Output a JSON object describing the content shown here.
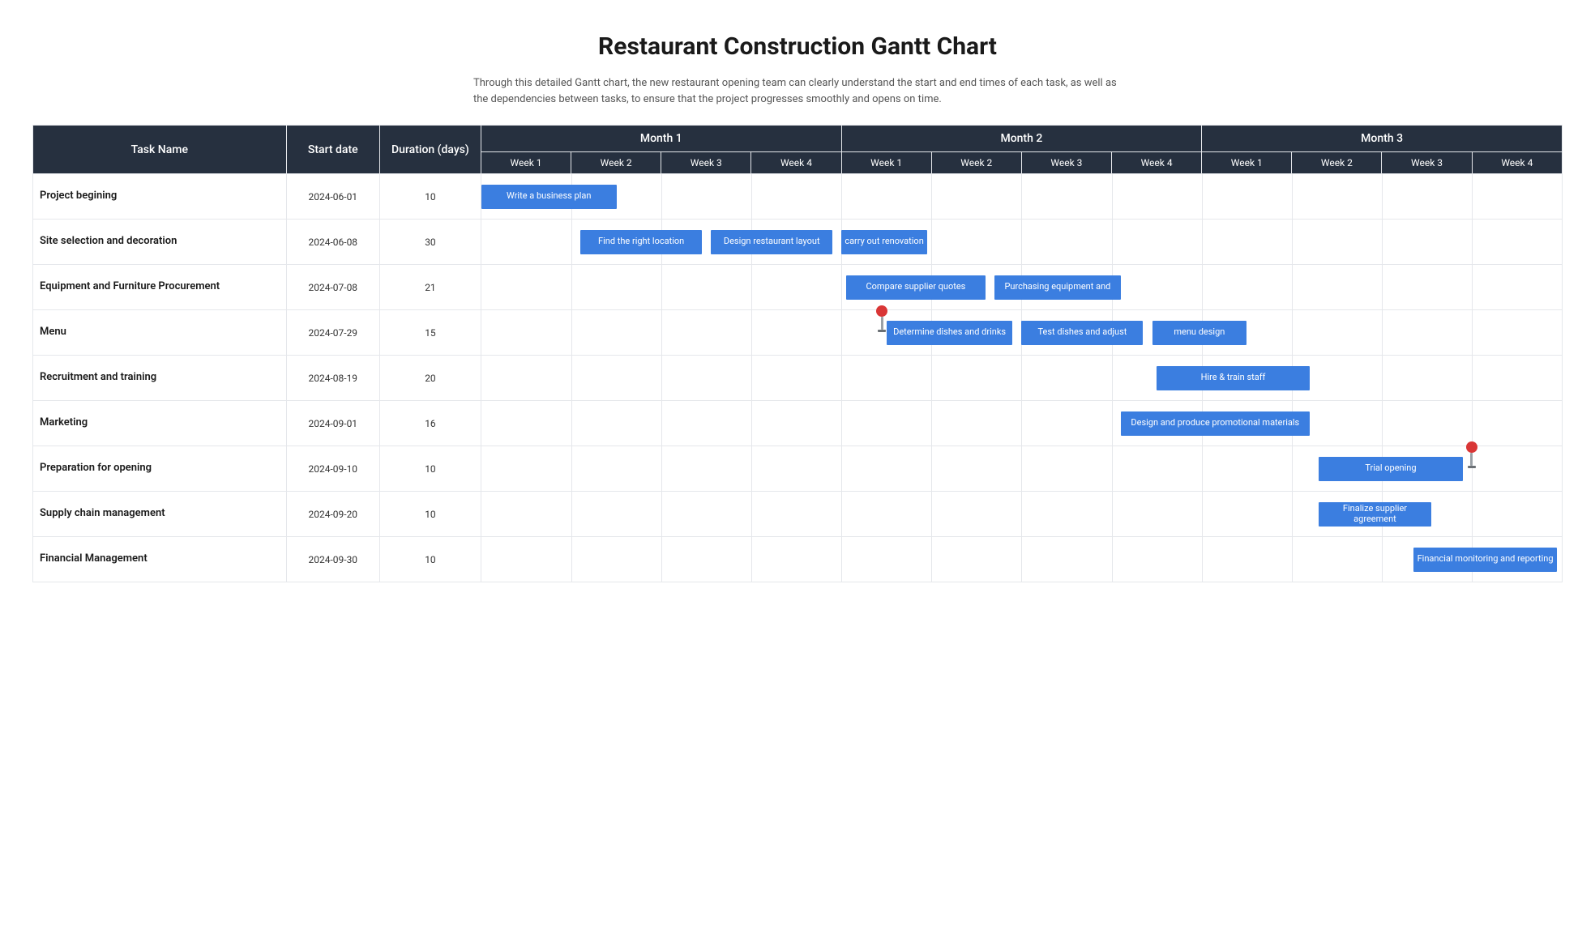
{
  "title": "Restaurant Construction Gantt Chart",
  "subtitle": "Through this detailed Gantt chart, the new restaurant opening team can clearly understand the start and end times of each task, as well as the dependencies between tasks, to ensure that the project progresses smoothly and opens on time.",
  "columns": {
    "task": "Task Name",
    "start": "Start date",
    "duration": "Duration (days)"
  },
  "months": [
    "Month 1",
    "Month 2",
    "Month 3"
  ],
  "weeks": [
    "Week 1",
    "Week 2",
    "Week 3",
    "Week 4"
  ],
  "rows": [
    {
      "name": "Project begining",
      "start": "2024-06-01",
      "duration": "10"
    },
    {
      "name": "Site selection and decoration",
      "start": "2024-06-08",
      "duration": "30"
    },
    {
      "name": "Equipment and Furniture Procurement",
      "start": "2024-07-08",
      "duration": "21"
    },
    {
      "name": "Menu",
      "start": "2024-07-29",
      "duration": "15"
    },
    {
      "name": "Recruitment and training",
      "start": "2024-08-19",
      "duration": "20"
    },
    {
      "name": "Marketing",
      "start": "2024-09-01",
      "duration": "16"
    },
    {
      "name": "Preparation for opening",
      "start": "2024-09-10",
      "duration": "10"
    },
    {
      "name": "Supply chain management",
      "start": "2024-09-20",
      "duration": "10"
    },
    {
      "name": "Financial Management",
      "start": "2024-09-30",
      "duration": "10"
    }
  ],
  "chart_data": {
    "type": "gantt",
    "time_unit": "week",
    "total_weeks": 12,
    "months": [
      "Month 1",
      "Month 2",
      "Month 3"
    ],
    "week_labels": [
      "Week 1",
      "Week 2",
      "Week 3",
      "Week 4",
      "Week 1",
      "Week 2",
      "Week 3",
      "Week 4",
      "Week 1",
      "Week 2",
      "Week 3",
      "Week 4"
    ],
    "tasks": [
      {
        "row": 0,
        "name": "Project begining",
        "start_date": "2024-06-01",
        "duration_days": 10,
        "bars": [
          {
            "label": "Write a business plan",
            "start_week": 0.0,
            "span_weeks": 1.5
          }
        ]
      },
      {
        "row": 1,
        "name": "Site selection and decoration",
        "start_date": "2024-06-08",
        "duration_days": 30,
        "bars": [
          {
            "label": "Find the right location",
            "start_week": 1.1,
            "span_weeks": 1.35
          },
          {
            "label": "Design restaurant layout",
            "start_week": 2.55,
            "span_weeks": 1.35
          },
          {
            "label": "carry out renovation",
            "start_week": 4.0,
            "span_weeks": 0.95
          }
        ]
      },
      {
        "row": 2,
        "name": "Equipment and Furniture Procurement",
        "start_date": "2024-07-08",
        "duration_days": 21,
        "bars": [
          {
            "label": "Compare supplier quotes",
            "start_week": 4.05,
            "span_weeks": 1.55
          },
          {
            "label": "Purchasing equipment and",
            "start_week": 5.7,
            "span_weeks": 1.4
          }
        ]
      },
      {
        "row": 3,
        "name": "Menu",
        "start_date": "2024-07-29",
        "duration_days": 15,
        "bars": [
          {
            "label": "Determine dishes and drinks",
            "start_week": 4.5,
            "span_weeks": 1.4
          },
          {
            "label": "Test dishes and adjust",
            "start_week": 6.0,
            "span_weeks": 1.35
          },
          {
            "label": "menu design",
            "start_week": 7.45,
            "span_weeks": 1.05
          }
        ],
        "pins": [
          {
            "at_week": 4.45
          }
        ]
      },
      {
        "row": 4,
        "name": "Recruitment and training",
        "start_date": "2024-08-19",
        "duration_days": 20,
        "bars": [
          {
            "label": "Hire & train staff",
            "start_week": 7.5,
            "span_weeks": 1.7
          }
        ]
      },
      {
        "row": 5,
        "name": "Marketing",
        "start_date": "2024-09-01",
        "duration_days": 16,
        "bars": [
          {
            "label": "Design and produce promotional materials",
            "start_week": 7.1,
            "span_weeks": 2.1
          }
        ]
      },
      {
        "row": 6,
        "name": "Preparation for opening",
        "start_date": "2024-09-10",
        "duration_days": 10,
        "bars": [
          {
            "label": "Trial opening",
            "start_week": 9.3,
            "span_weeks": 1.6
          }
        ],
        "pins": [
          {
            "at_week": 11.0
          }
        ]
      },
      {
        "row": 7,
        "name": "Supply chain management",
        "start_date": "2024-09-20",
        "duration_days": 10,
        "bars": [
          {
            "label": "Finalize supplier agreement",
            "start_week": 9.3,
            "span_weeks": 1.25
          }
        ]
      },
      {
        "row": 8,
        "name": "Financial Management",
        "start_date": "2024-09-30",
        "duration_days": 10,
        "bars": [
          {
            "label": "Financial monitoring and reporting",
            "start_week": 10.35,
            "span_weeks": 1.6
          }
        ]
      }
    ]
  }
}
